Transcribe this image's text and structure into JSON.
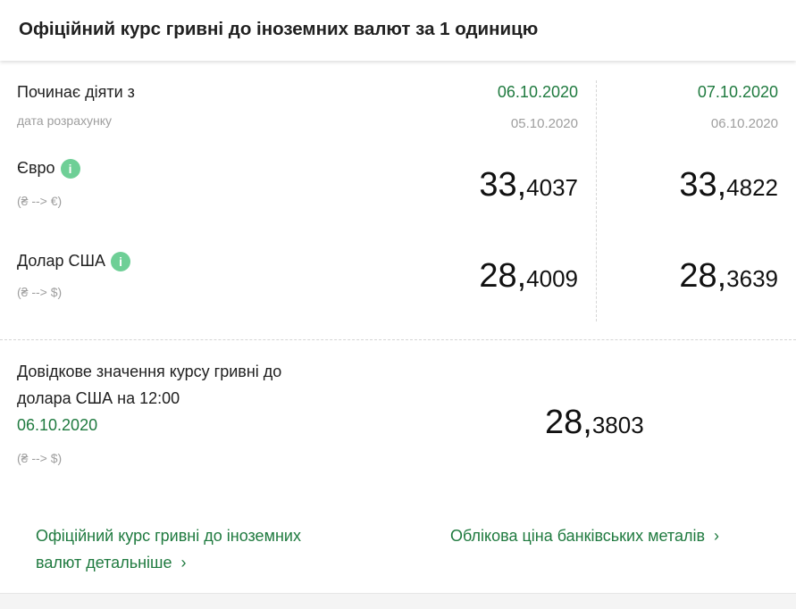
{
  "header": {
    "title": "Офіційний курс гривні до іноземних валют за 1 одиницю"
  },
  "table": {
    "effective_label": "Починає діяти з",
    "calc_label": "дата розрахунку",
    "columns": [
      {
        "effective_date": "06.10.2020",
        "calc_date": "05.10.2020"
      },
      {
        "effective_date": "07.10.2020",
        "calc_date": "06.10.2020"
      }
    ],
    "rows": [
      {
        "name": "Євро",
        "direction": "(₴ --> €)",
        "info_icon": "i",
        "values": [
          {
            "int": "33,",
            "frac": "4037"
          },
          {
            "int": "33,",
            "frac": "4822"
          }
        ]
      },
      {
        "name": "Долар США",
        "direction": "(₴ --> $)",
        "info_icon": "i",
        "values": [
          {
            "int": "28,",
            "frac": "4009"
          },
          {
            "int": "28,",
            "frac": "3639"
          }
        ]
      }
    ]
  },
  "reference": {
    "line1": "Довідкове значення курсу гривні до",
    "line2": "долара США на 12:00",
    "date": "06.10.2020",
    "direction": "(₴ --> $)",
    "value_int": "28,",
    "value_frac": "3803"
  },
  "links": {
    "detailed_line1": "Офіційний курс гривні до іноземних",
    "detailed_line2": "валют детальніше",
    "metals": "Облікова ціна банківських металів",
    "chevron": "›"
  },
  "colors": {
    "accent_green": "#1f7a3f",
    "info_icon_bg": "#6ecf96",
    "muted": "#9e9e9e"
  }
}
